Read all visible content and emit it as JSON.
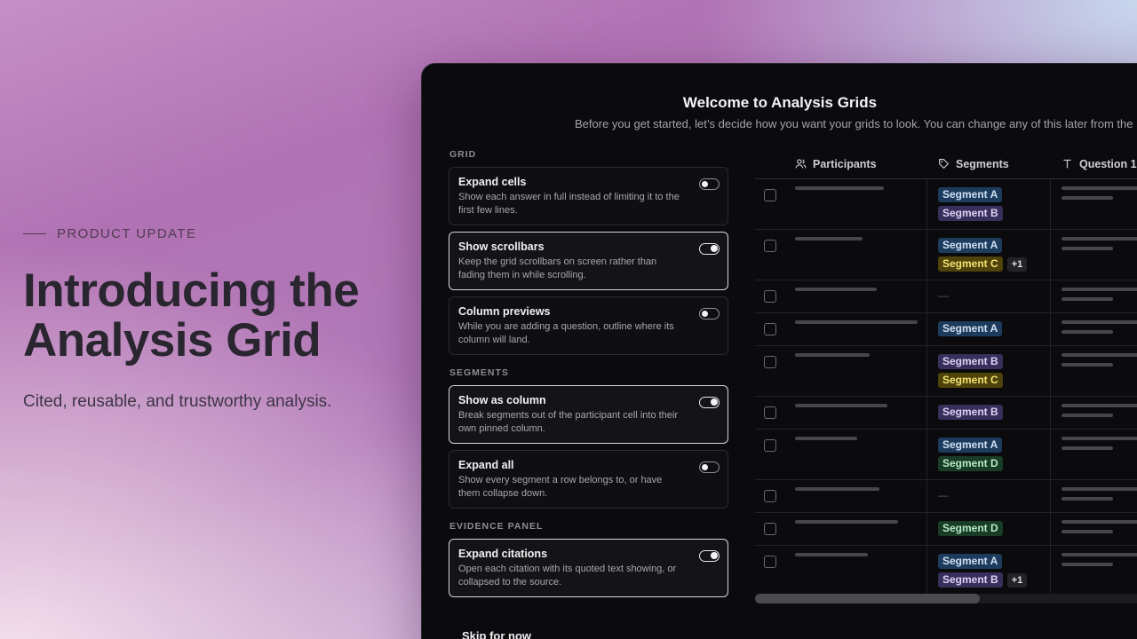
{
  "hero": {
    "eyebrow": "PRODUCT UPDATE",
    "headline_1": "Introducing the",
    "headline_2": "Analysis Grid",
    "tagline": "Cited, reusable, and trustworthy analysis."
  },
  "dialog": {
    "title": "Welcome to Analysis Grids",
    "subtitle": "Before you get started, let’s decide how you want your grids to look. You can change any of this later from the",
    "skip_label": "Skip for now"
  },
  "settings": [
    {
      "section": "GRID",
      "items": [
        {
          "title": "Expand cells",
          "desc": "Show each answer in full instead of limiting it to the first few lines.",
          "on": false
        },
        {
          "title": "Show scrollbars",
          "desc": "Keep the grid scrollbars on screen rather than fading them in while scrolling.",
          "on": true
        },
        {
          "title": "Column previews",
          "desc": "While you are adding a question, outline where its column will land.",
          "on": false
        }
      ]
    },
    {
      "section": "SEGMENTS",
      "items": [
        {
          "title": "Show as column",
          "desc": "Break segments out of the participant cell into their own pinned column.",
          "on": true
        },
        {
          "title": "Expand all",
          "desc": "Show every segment a row belongs to, or have them collapse down.",
          "on": false
        }
      ]
    },
    {
      "section": "EVIDENCE PANEL",
      "items": [
        {
          "title": "Expand citations",
          "desc": "Open each citation with its quoted text showing, or collapsed to the source.",
          "on": true
        }
      ]
    }
  ],
  "grid": {
    "columns": [
      {
        "label": "Participants",
        "icon": "users-icon"
      },
      {
        "label": "Segments",
        "icon": "tag-icon"
      },
      {
        "label": "Question 1",
        "icon": "text-icon"
      }
    ],
    "rows": [
      {
        "segments": [
          [
            "Segment A"
          ],
          [
            "Segment B"
          ]
        ]
      },
      {
        "segments": [
          [
            "Segment A"
          ],
          [
            "Segment C",
            "+1"
          ]
        ]
      },
      {
        "segments": []
      },
      {
        "segments": [
          [
            "Segment A"
          ]
        ]
      },
      {
        "segments": [
          [
            "Segment B"
          ],
          [
            "Segment C"
          ]
        ]
      },
      {
        "segments": [
          [
            "Segment B"
          ]
        ]
      },
      {
        "segments": [
          [
            "Segment A"
          ],
          [
            "Segment D"
          ]
        ]
      },
      {
        "segments": []
      },
      {
        "segments": [
          [
            "Segment D"
          ]
        ]
      },
      {
        "segments": [
          [
            "Segment A"
          ],
          [
            "Segment B",
            "+1"
          ]
        ]
      }
    ],
    "empty_marker": "—",
    "scroll_position": 0.55
  },
  "colors": {
    "segment_a": "#1d3b5c",
    "segment_b": "#392f5c",
    "segment_c": "#4e430b",
    "segment_d": "#183c26"
  }
}
